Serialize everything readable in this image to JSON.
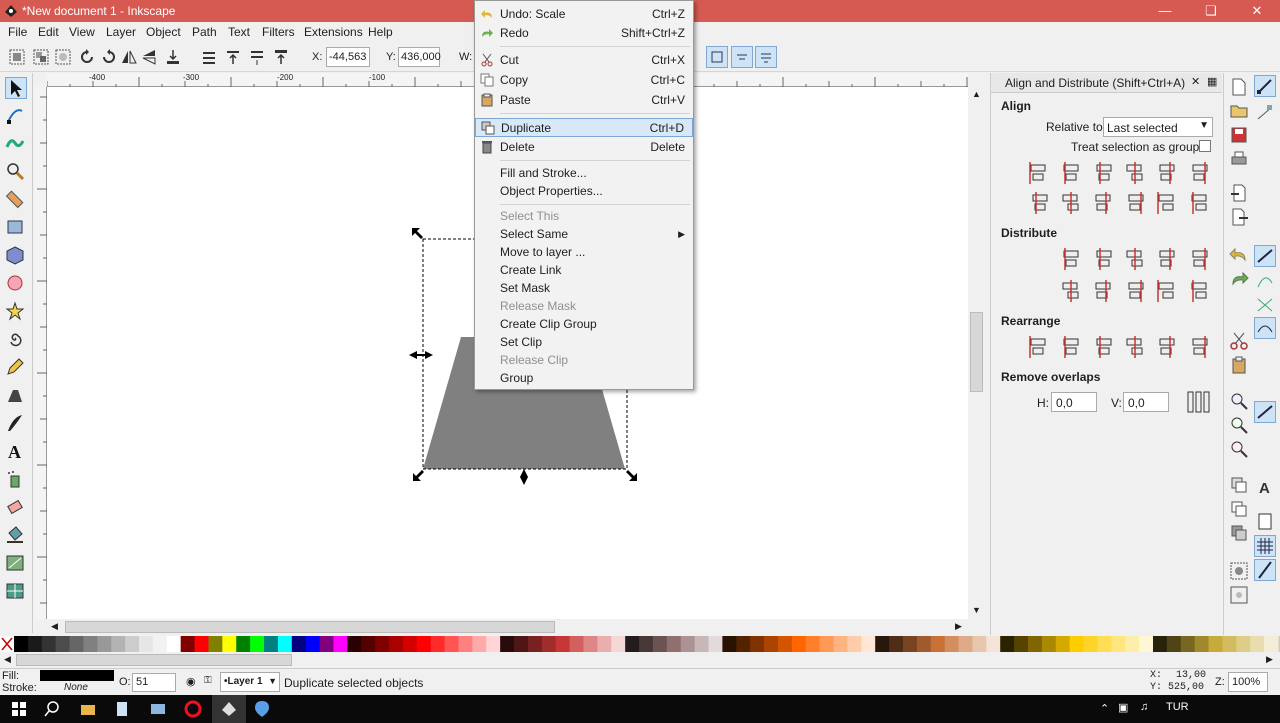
{
  "window": {
    "title": "*New document 1 - Inkscape"
  },
  "menubar": [
    "File",
    "Edit",
    "View",
    "Layer",
    "Object",
    "Path",
    "Text",
    "Filters",
    "Extensions",
    "Help"
  ],
  "toolbar": {
    "x_label": "X:",
    "x_value": "-44,563",
    "y_label": "Y:",
    "y_value": "436,000",
    "w_label": "W:"
  },
  "ruler": {
    "top_ticks": [
      "-400",
      "-300",
      "-200",
      "-100"
    ],
    "left_ticks": [
      "1",
      "0",
      "0",
      "0",
      "0",
      "0",
      "0",
      "0"
    ]
  },
  "context_menu": {
    "items": [
      {
        "label": "Undo: Scale",
        "shortcut": "Ctrl+Z",
        "icon": "undo-icon",
        "state": "normal"
      },
      {
        "label": "Redo",
        "shortcut": "Shift+Ctrl+Z",
        "icon": "redo-icon",
        "state": "normal"
      },
      {
        "label": "Cut",
        "shortcut": "Ctrl+X",
        "icon": "cut-icon",
        "state": "normal"
      },
      {
        "label": "Copy",
        "shortcut": "Ctrl+C",
        "icon": "copy-icon",
        "state": "normal"
      },
      {
        "label": "Paste",
        "shortcut": "Ctrl+V",
        "icon": "paste-icon",
        "state": "normal"
      },
      {
        "label": "Duplicate",
        "shortcut": "Ctrl+D",
        "icon": "duplicate-icon",
        "state": "highlighted"
      },
      {
        "label": "Delete",
        "shortcut": "Delete",
        "icon": "delete-icon",
        "state": "normal"
      },
      {
        "label": "Fill and Stroke...",
        "shortcut": "",
        "icon": "",
        "state": "normal"
      },
      {
        "label": "Object Properties...",
        "shortcut": "",
        "icon": "",
        "state": "normal"
      },
      {
        "label": "Select This",
        "shortcut": "",
        "icon": "",
        "state": "disabled"
      },
      {
        "label": "Select Same",
        "shortcut": "",
        "icon": "",
        "state": "submenu"
      },
      {
        "label": "Move to layer ...",
        "shortcut": "",
        "icon": "",
        "state": "normal"
      },
      {
        "label": "Create Link",
        "shortcut": "",
        "icon": "",
        "state": "normal"
      },
      {
        "label": "Set Mask",
        "shortcut": "",
        "icon": "",
        "state": "normal"
      },
      {
        "label": "Release Mask",
        "shortcut": "",
        "icon": "",
        "state": "disabled"
      },
      {
        "label": "Create Clip Group",
        "shortcut": "",
        "icon": "",
        "state": "normal"
      },
      {
        "label": "Set Clip",
        "shortcut": "",
        "icon": "",
        "state": "normal"
      },
      {
        "label": "Release Clip",
        "shortcut": "",
        "icon": "",
        "state": "disabled"
      },
      {
        "label": "Group",
        "shortcut": "",
        "icon": "",
        "state": "normal"
      }
    ]
  },
  "panel": {
    "title": "Align and Distribute (Shift+Ctrl+A)",
    "align_heading": "Align",
    "relative_to_label": "Relative to:",
    "relative_to_value": "Last selected",
    "treat_selection_label": "Treat selection as group:",
    "distribute_heading": "Distribute",
    "rearrange_heading": "Rearrange",
    "remove_overlaps_heading": "Remove overlaps",
    "h_label": "H:",
    "h_value": "0,0",
    "v_label": "V:",
    "v_value": "0,0"
  },
  "status": {
    "fill_label": "Fill:",
    "stroke_label": "Stroke:",
    "stroke_value": "None",
    "opacity_label": "O:",
    "opacity_value": "51",
    "layer_value": "•Layer 1",
    "message": "Duplicate selected objects",
    "x_label": "X:",
    "x_value": "13,00",
    "y_label": "Y:",
    "y_value": "525,00",
    "zoom_label": "Z:",
    "zoom_value": "100%"
  },
  "taskbar": {
    "lang": "TUR"
  },
  "colors": {
    "titlebar": "#d75a52",
    "selection_highlight": "#d8e8f8",
    "shape_fill": "#808080"
  }
}
